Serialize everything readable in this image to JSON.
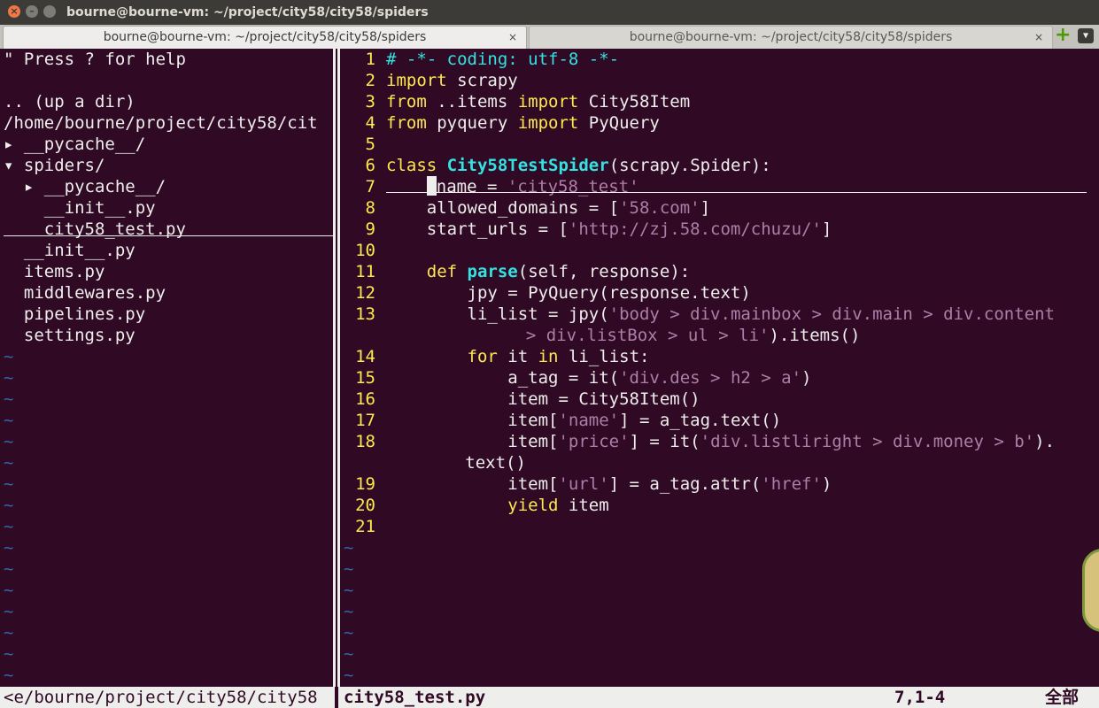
{
  "window": {
    "title": "bourne@bourne-vm: ~/project/city58/city58/spiders"
  },
  "tabs": [
    {
      "label": "bourne@bourne-vm: ~/project/city58/city58/spiders",
      "close": "×"
    },
    {
      "label": "bourne@bourne-vm: ~/project/city58/city58/spiders",
      "close": "×"
    }
  ],
  "tree": {
    "lines": [
      "\" Press ? for help",
      "",
      ".. (up a dir)",
      "/home/bourne/project/city58/cit",
      "▸ __pycache__/",
      "▾ spiders/",
      "  ▸ __pycache__/",
      "    __init__.py",
      "    city58_test.py",
      "  __init__.py",
      "  items.py",
      "  middlewares.py",
      "  pipelines.py",
      "  settings.py"
    ],
    "tilde": "~"
  },
  "code": {
    "line_numbers": [
      "1",
      "2",
      "3",
      "4",
      "5",
      "6",
      "7",
      "8",
      "9",
      "10",
      "11",
      "12",
      "13",
      "14",
      "15",
      "16",
      "17",
      "18",
      "19",
      "20",
      "21"
    ],
    "tilde": "~"
  },
  "status": {
    "left": "<e/bourne/project/city58/city58",
    "file": "city58_test.py",
    "position": "7,1-4",
    "scroll": "全部"
  },
  "colors": {
    "background": "#300a24",
    "foreground": "#eeeeec",
    "keyword": "#fce94f",
    "class_name": "#34e2e2",
    "string": "#ad7fa8",
    "tilde": "#3465a4"
  }
}
